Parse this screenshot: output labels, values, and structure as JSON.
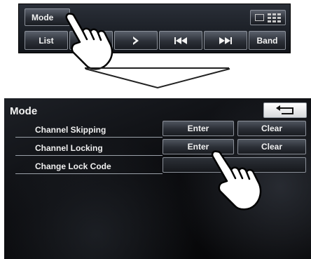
{
  "top_panel": {
    "mode_label": "Mode",
    "list_label": "List",
    "band_label": "Band",
    "next_icon": "chevron-right-icon",
    "prev_icon": "skip-back-icon",
    "fwd_icon": "skip-forward-icon",
    "grid_icon": "display-grid-icon"
  },
  "screen": {
    "title": "Mode",
    "back_icon": "return-arrow-icon",
    "rows": [
      {
        "label": "Channel Skipping",
        "enter": "Enter",
        "clear": "Clear"
      },
      {
        "label": "Channel Locking",
        "enter": "Enter",
        "clear": "Clear"
      },
      {
        "label": "Change Lock Code",
        "enter": "",
        "clear": ""
      }
    ]
  },
  "colors": {
    "panel_bg": "#15181d",
    "screen_bg": "#0b0c0f",
    "button_border": "#8b9099",
    "text": "#f2f2f2"
  }
}
